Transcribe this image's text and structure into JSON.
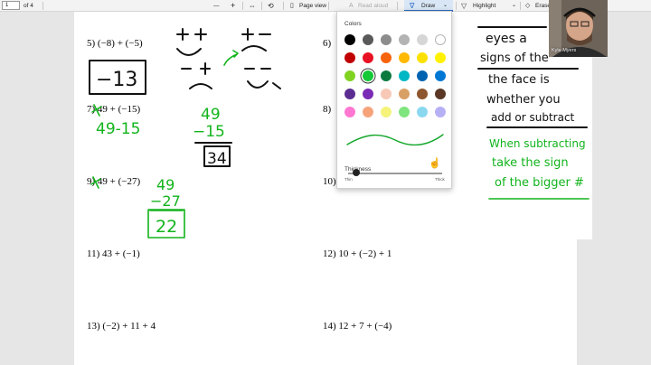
{
  "toolbar": {
    "page_number": "1",
    "page_count": "of 4",
    "zoom_out": "—",
    "zoom_in": "+",
    "page_view": "Page view",
    "read_aloud": "Read aloud",
    "draw": "Draw",
    "highlight": "Highlight",
    "erase": "Erase"
  },
  "worksheet": {
    "p5": "5)  (−8) + (−5)",
    "p6": "6)",
    "p7": "7) 49 + (−15)",
    "p8": "8)",
    "p9": "9) 49 + (−27)",
    "p10": "10)",
    "p11": "11)  43 + (−1)",
    "p12": "12)  10 + (−2) + 1",
    "p13": "13)  (−2) + 11 + 4",
    "p14": "14)  12 + 7 + (−4)"
  },
  "handwriting": {
    "answer5": "−13",
    "work7": "49-15",
    "vertical7_top": "49",
    "vertical7_mid": "−15",
    "vertical7_ans": "34",
    "vertical9_top": "49",
    "vertical9_mid": "−27",
    "vertical9_ans": "22",
    "notes_black": [
      "eyes a",
      "signs of the",
      "the face is",
      "whether you",
      "add or subtract"
    ],
    "notes_green": [
      "When subtracting",
      "take the sign",
      "of the bigger #"
    ]
  },
  "draw_panel": {
    "colors_title": "Colors",
    "colors": [
      "#000000",
      "#595959",
      "#8c8c8c",
      "#b3b3b3",
      "#d6d6d6",
      "#ffffff",
      "#c00000",
      "#e81123",
      "#f7630c",
      "#ffb900",
      "#fce100",
      "#fff100",
      "#7fd320",
      "#13c936",
      "#0b7a3e",
      "#00b7c3",
      "#0063b1",
      "#0078d4",
      "#5c2d91",
      "#7a2bb5",
      "#f7c8b5",
      "#d9a066",
      "#8e562e",
      "#5a3825",
      "#ff77d1",
      "#f7a37a",
      "#f5f37a",
      "#7fe57e",
      "#89d8f0",
      "#b6b0f5"
    ],
    "selected_index": 13,
    "pen_color": "#13a72a",
    "thickness_title": "Thickness",
    "thin_label": "Thin",
    "thick_label": "Thick",
    "thickness_value": 0.05
  },
  "webcam": {
    "name": "Kyle Myers"
  }
}
